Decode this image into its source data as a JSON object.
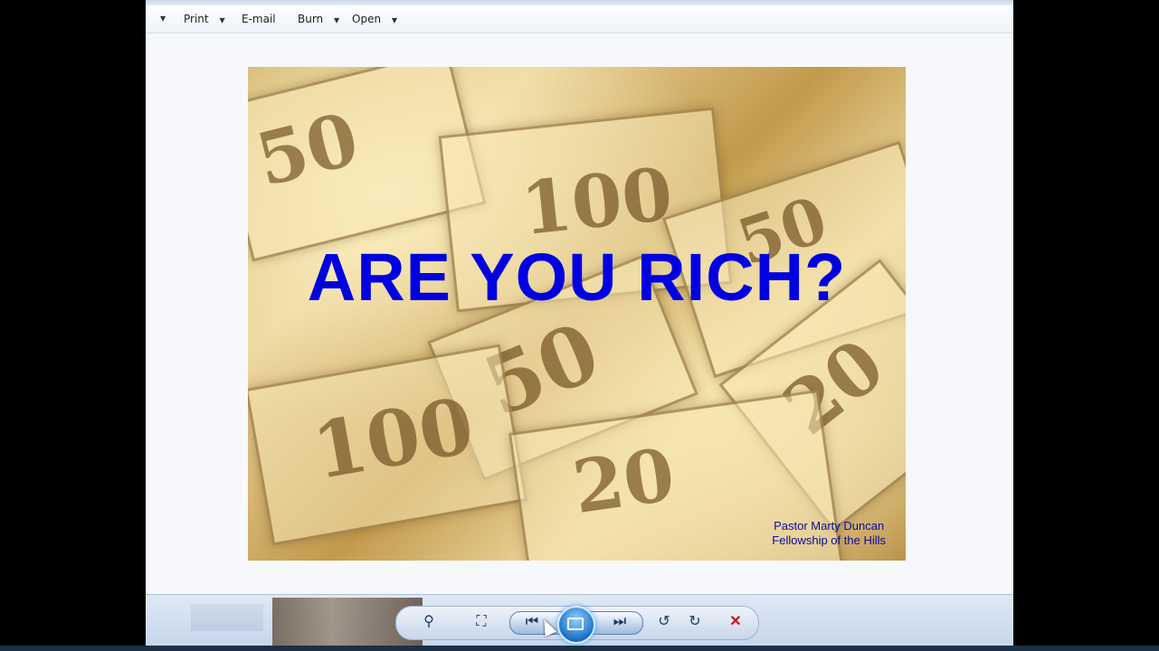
{
  "menu": {
    "items": [
      {
        "label": "Print"
      },
      {
        "label": "E-mail"
      },
      {
        "label": "Burn"
      },
      {
        "label": "Open"
      }
    ]
  },
  "slide": {
    "title": "ARE YOU RICH?",
    "credit_line1": "Pastor Marty Duncan",
    "credit_line2": "Fellowship of the Hills",
    "bill_numbers": [
      "50",
      "100",
      "50",
      "50",
      "20",
      "100",
      "20"
    ]
  },
  "controls": {
    "zoom_icon": "⚲",
    "actual_size_icon": "⛶",
    "prev_icon": "⏮",
    "play_icon": "slideshow-icon",
    "next_icon": "⏭",
    "rotate_ccw_icon": "↺",
    "rotate_cw_icon": "↻",
    "delete_icon": "✕"
  },
  "colors": {
    "title": "#0000e0",
    "credit": "#0a0a9a",
    "delete": "#d01010"
  }
}
